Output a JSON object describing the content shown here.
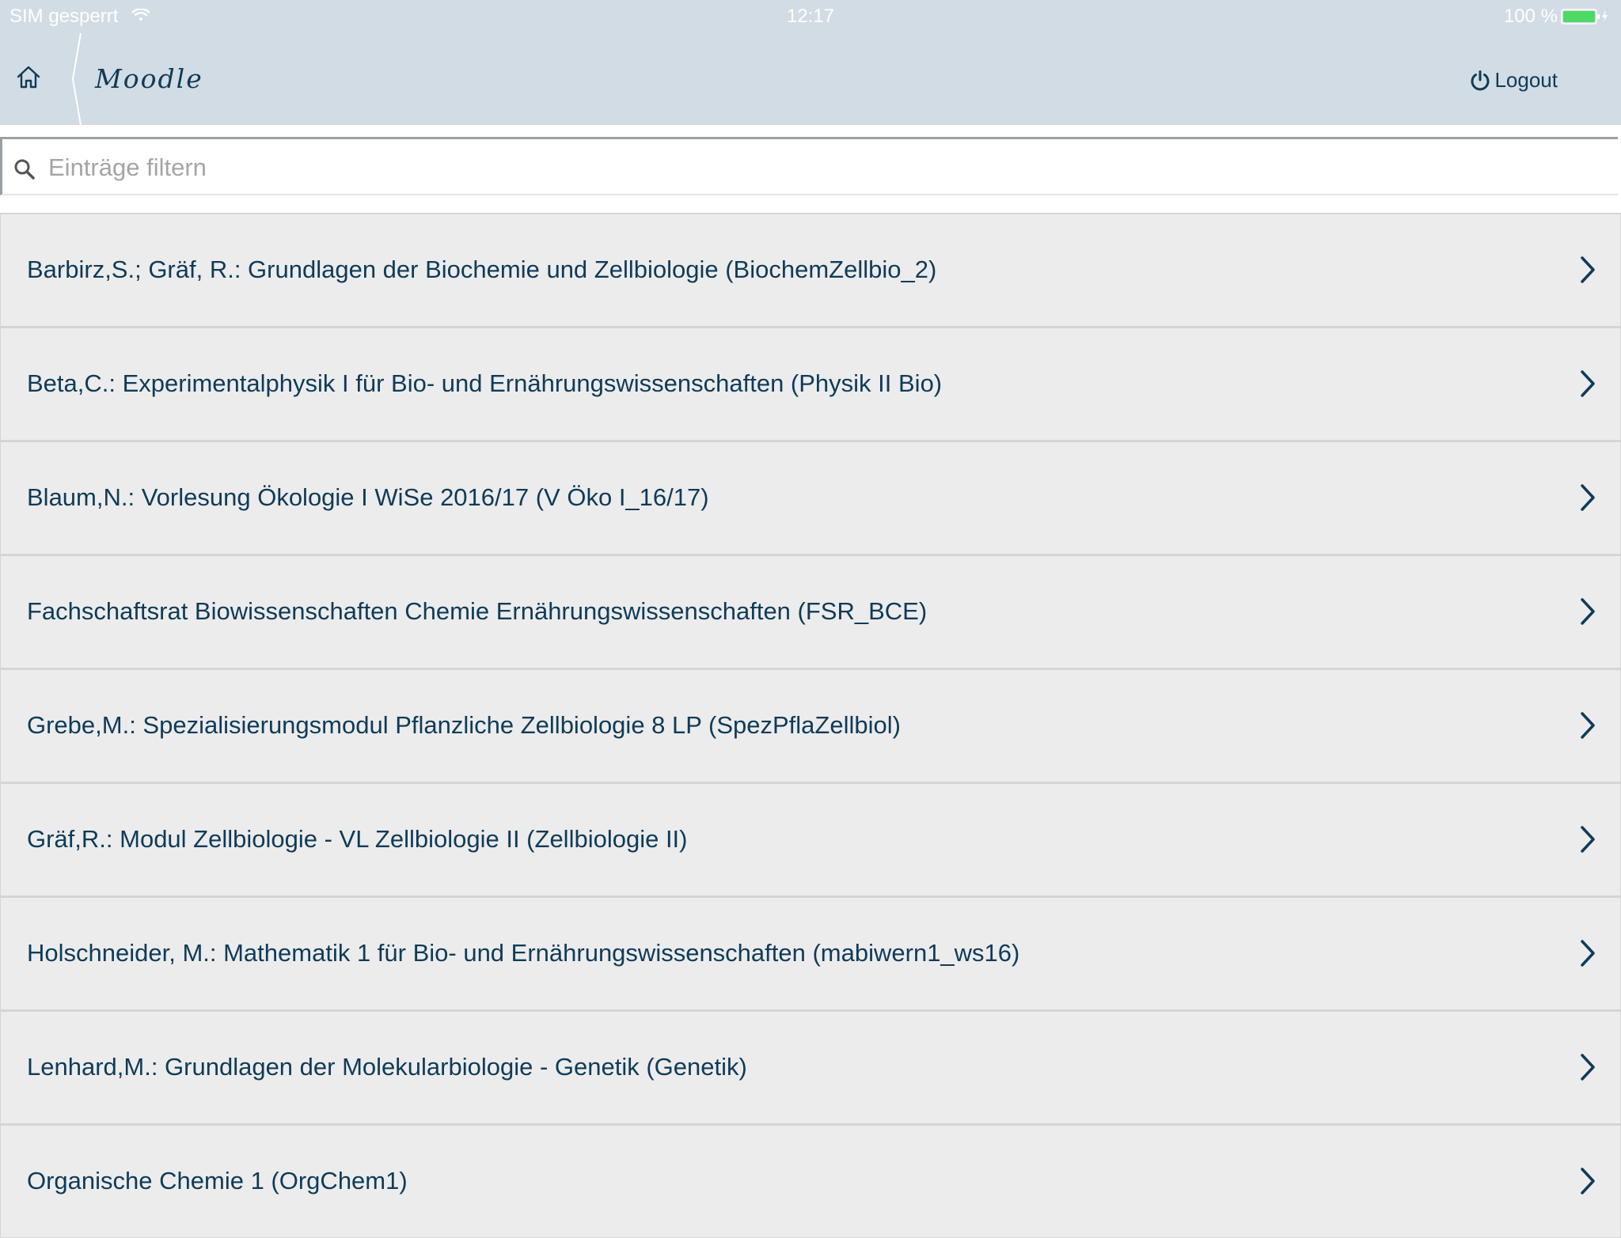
{
  "status_bar": {
    "carrier": "SIM gesperrt",
    "time": "12:17",
    "battery_text": "100 %"
  },
  "nav": {
    "title": "Moodle",
    "logout_label": "Logout"
  },
  "search": {
    "placeholder": "Einträge filtern",
    "value": ""
  },
  "courses": [
    {
      "label": "Barbirz,S.; Gräf, R.: Grundlagen der Biochemie und Zellbiologie (BiochemZellbio_2)"
    },
    {
      "label": "Beta,C.: Experimentalphysik I für Bio- und Ernährungswissenschaften (Physik II Bio)"
    },
    {
      "label": "Blaum,N.: Vorlesung Ökologie I WiSe 2016/17 (V Öko I_16/17)"
    },
    {
      "label": "Fachschaftsrat Biowissenschaften Chemie Ernährungswissenschaften (FSR_BCE)"
    },
    {
      "label": "Grebe,M.: Spezialisierungsmodul Pflanzliche Zellbiologie 8 LP (SpezPflaZellbiol)"
    },
    {
      "label": "Gräf,R.: Modul Zellbiologie - VL Zellbiologie II (Zellbiologie II)"
    },
    {
      "label": "Holschneider, M.: Mathematik 1 für Bio- und Ernährungswissenschaften (mabiwern1_ws16)"
    },
    {
      "label": "Lenhard,M.: Grundlagen der Molekularbiologie - Genetik (Genetik)"
    },
    {
      "label": "Organische Chemie 1 (OrgChem1)"
    }
  ],
  "colors": {
    "header_bg": "#d2dce4",
    "text_primary": "#0f3b58",
    "row_bg": "#ececec",
    "battery": "#4cd964"
  },
  "icons": {
    "home": "home-icon",
    "logout": "power-icon",
    "search": "search-icon",
    "row": "chevron-right-icon"
  }
}
